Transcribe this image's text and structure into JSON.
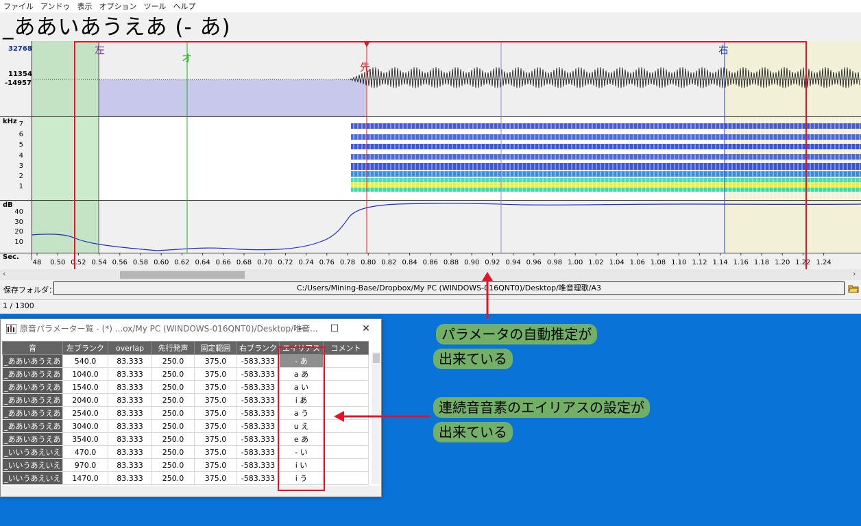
{
  "menu": [
    "ファイル",
    "アンドゥ",
    "表示",
    "オプション",
    "ツール",
    "ヘルプ"
  ],
  "header": {
    "phoneme_title": "_ああいあうえあ (- あ)"
  },
  "waveform": {
    "ylabels": [
      "32768",
      "11354",
      "-14957"
    ],
    "markers": {
      "left": "左",
      "overlap": "オ",
      "preutterance": "先",
      "right": "右"
    }
  },
  "spectrogram": {
    "unit": "kHz",
    "ticks": [
      "7",
      "6",
      "5",
      "4",
      "3",
      "2",
      "1"
    ]
  },
  "power": {
    "unit": "dB",
    "ticks": [
      "40",
      "30",
      "20",
      "10"
    ]
  },
  "time_axis": {
    "unit": "Sec.",
    "ticks": [
      "48",
      "0.50",
      "0.52",
      "0.54",
      "0.56",
      "0.58",
      "0.60",
      "0.62",
      "0.64",
      "0.66",
      "0.68",
      "0.70",
      "0.72",
      "0.74",
      "0.76",
      "0.78",
      "0.80",
      "0.82",
      "0.84",
      "0.86",
      "0.88",
      "0.90",
      "0.92",
      "0.94",
      "0.96",
      "0.98",
      "1.00",
      "1.02",
      "1.04",
      "1.06",
      "1.08",
      "1.10",
      "1.12",
      "1.14",
      "1.16",
      "1.18",
      "1.20",
      "1.22",
      "1.24"
    ]
  },
  "folder": {
    "label": "保存フォルダ：",
    "path": "C:/Users/Mining-Base/Dropbox/My PC (WINDOWS-016QNT0)/Desktop/唯音理歌/A3"
  },
  "status": {
    "counter": "1 / 1300"
  },
  "param_window": {
    "title": "原音パラメーター覧 - (*) ...ox/My PC (WINDOWS-016QNT0)/Desktop/唯音...",
    "buttons": {
      "minimize": "—",
      "maximize": "☐",
      "close": "✕"
    },
    "columns": [
      "音",
      "左ブランク",
      "overlap",
      "先行発声",
      "固定範囲",
      "右ブランク",
      "エイリアス",
      "コメント"
    ],
    "rows": [
      [
        "_ああいあうえあ",
        "540.0",
        "83.333",
        "250.0",
        "375.0",
        "-583.333",
        "- あ",
        ""
      ],
      [
        "_ああいあうえあ",
        "1040.0",
        "83.333",
        "250.0",
        "375.0",
        "-583.333",
        "a あ",
        ""
      ],
      [
        "_ああいあうえあ",
        "1540.0",
        "83.333",
        "250.0",
        "375.0",
        "-583.333",
        "a い",
        ""
      ],
      [
        "_ああいあうえあ",
        "2040.0",
        "83.333",
        "250.0",
        "375.0",
        "-583.333",
        "i あ",
        ""
      ],
      [
        "_ああいあうえあ",
        "2540.0",
        "83.333",
        "250.0",
        "375.0",
        "-583.333",
        "a う",
        ""
      ],
      [
        "_ああいあうえあ",
        "3040.0",
        "83.333",
        "250.0",
        "375.0",
        "-583.333",
        "u え",
        ""
      ],
      [
        "_ああいあうえあ",
        "3540.0",
        "83.333",
        "250.0",
        "375.0",
        "-583.333",
        "e あ",
        ""
      ],
      [
        "_いいうあえいえ",
        "470.0",
        "83.333",
        "250.0",
        "375.0",
        "-583.333",
        "- い",
        ""
      ],
      [
        "_いいうあえいえ",
        "970.0",
        "83.333",
        "250.0",
        "375.0",
        "-583.333",
        "i い",
        ""
      ],
      [
        "_いいうあえいえ",
        "1470.0",
        "83.333",
        "250.0",
        "375.0",
        "-583.333",
        "i う",
        ""
      ]
    ]
  },
  "annotations": {
    "top_line1": "パラメータの自動推定が",
    "top_line2": "出来ている",
    "bottom_line1": "連続音音素のエイリアスの設定が",
    "bottom_line2": "出来ている",
    "color": "#e8102a"
  }
}
